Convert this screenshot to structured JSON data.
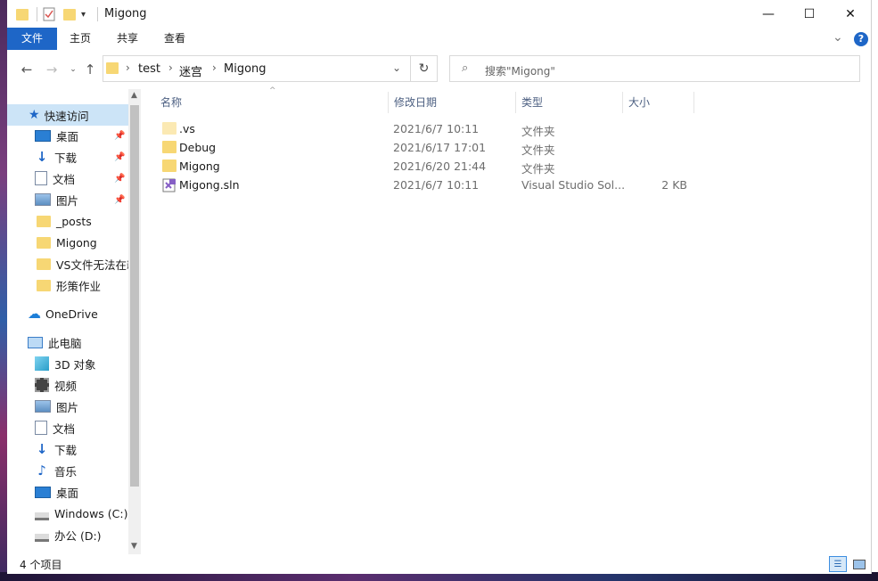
{
  "window": {
    "title": "Migong",
    "controls": {
      "minimize": "—",
      "maximize": "☐",
      "close": "✕"
    }
  },
  "ribbon": {
    "tabs": [
      "文件",
      "主页",
      "共享",
      "查看"
    ],
    "help": "?",
    "expand": "⌄"
  },
  "address": {
    "crumbs": [
      "test",
      "迷宫",
      "Migong"
    ],
    "search_placeholder": "搜索\"Migong\""
  },
  "nav": {
    "quick_access": "快速访问",
    "pinned": [
      {
        "label": "桌面",
        "icon": "desktop-icon"
      },
      {
        "label": "下载",
        "icon": "download-icon"
      },
      {
        "label": "文档",
        "icon": "document-icon"
      },
      {
        "label": "图片",
        "icon": "pictures-icon"
      }
    ],
    "recent": [
      "_posts",
      "Migong",
      "VS文件无法在新",
      "形策作业"
    ],
    "onedrive": "OneDrive",
    "this_pc": "此电脑",
    "pc_items": [
      {
        "label": "3D 对象",
        "icon": "3d-objects-icon"
      },
      {
        "label": "视频",
        "icon": "video-icon"
      },
      {
        "label": "图片",
        "icon": "pictures-icon"
      },
      {
        "label": "文档",
        "icon": "document-icon"
      },
      {
        "label": "下载",
        "icon": "download-icon"
      },
      {
        "label": "音乐",
        "icon": "music-icon"
      },
      {
        "label": "桌面",
        "icon": "desktop-icon"
      },
      {
        "label": "Windows (C:)",
        "icon": "drive-c-icon"
      },
      {
        "label": "办公 (D:)",
        "icon": "drive-d-icon"
      }
    ]
  },
  "columns": {
    "name": "名称",
    "date": "修改日期",
    "type": "类型",
    "size": "大小"
  },
  "files": [
    {
      "name": ".vs",
      "date": "2021/6/7 10:11",
      "type": "文件夹",
      "size": "",
      "icon": "folder-hidden-icon"
    },
    {
      "name": "Debug",
      "date": "2021/6/17 17:01",
      "type": "文件夹",
      "size": "",
      "icon": "folder-icon"
    },
    {
      "name": "Migong",
      "date": "2021/6/20 21:44",
      "type": "文件夹",
      "size": "",
      "icon": "folder-icon"
    },
    {
      "name": "Migong.sln",
      "date": "2021/6/7 10:11",
      "type": "Visual Studio Sol...",
      "size": "2 KB",
      "icon": "vs-solution-icon"
    }
  ],
  "status": {
    "count": "4 个项目"
  },
  "colors": {
    "accent": "#1e66c7",
    "selected": "#cce4f7",
    "folder": "#f7d774"
  }
}
